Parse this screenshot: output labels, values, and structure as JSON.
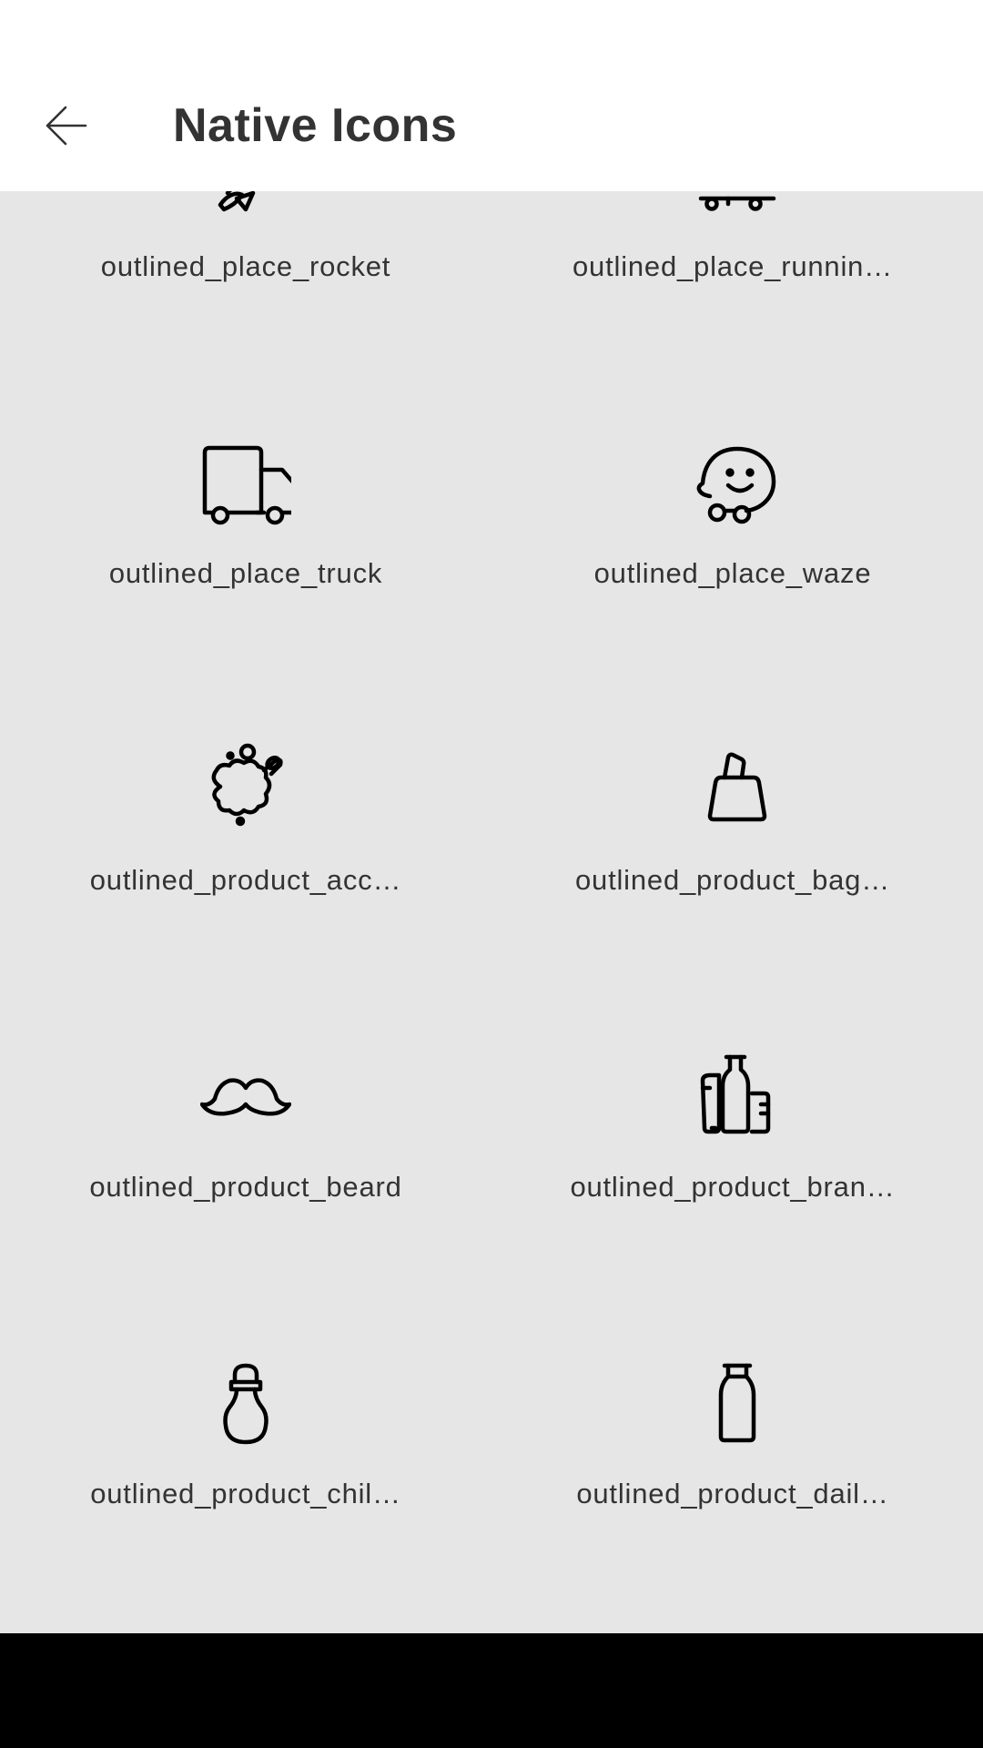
{
  "app_bar": {
    "title": "Native Icons",
    "back_icon": "arrow-left-icon"
  },
  "icons": [
    {
      "label": "outlined_place_rocket",
      "icon": "rocket-icon"
    },
    {
      "label": "outlined_place_runnin…",
      "icon": "running-icon"
    },
    {
      "label": "outlined_place_truck",
      "icon": "truck-icon"
    },
    {
      "label": "outlined_place_waze",
      "icon": "waze-icon"
    },
    {
      "label": "outlined_product_acc…",
      "icon": "soap-bubbles-icon"
    },
    {
      "label": "outlined_product_bag…",
      "icon": "bag-icon"
    },
    {
      "label": "outlined_product_beard",
      "icon": "beard-icon"
    },
    {
      "label": "outlined_product_bran…",
      "icon": "bottles-icon"
    },
    {
      "label": "outlined_product_chil…",
      "icon": "baby-bottle-icon"
    },
    {
      "label": "outlined_product_dail…",
      "icon": "milk-bottle-icon"
    }
  ],
  "colors": {
    "background": "#e6e6e6",
    "app_bar": "#ffffff",
    "text": "#333333",
    "nav_bar": "#000000"
  }
}
